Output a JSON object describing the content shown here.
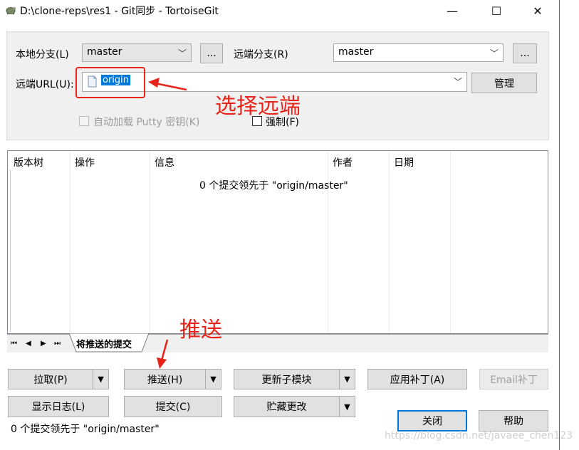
{
  "window": {
    "title": "D:\\clone-reps\\res1 - Git同步 - TortoiseGit",
    "controls": {
      "minimize": "—",
      "maximize": "☐",
      "close": "✕"
    }
  },
  "form": {
    "local_branch_label": "本地分支(L)",
    "local_branch_value": "master",
    "remote_branch_label": "远端分支(R)",
    "remote_branch_value": "master",
    "browse_label": "...",
    "remote_url_label": "远端URL(U):",
    "remote_url_value": "origin",
    "manage_label": "管理",
    "autoload_putty_label": "自动加载 Putty 密钥(K)",
    "force_label": "强制(F)"
  },
  "list": {
    "columns": [
      "版本树",
      "操作",
      "信息",
      "作者",
      "日期"
    ],
    "message": "0 个提交领先于 \"origin/master\""
  },
  "tabs": {
    "nav": [
      "⏮",
      "◀",
      "▶",
      "⏭"
    ],
    "active_tab": "将推送的提交"
  },
  "buttons": {
    "pull": "拉取(P)",
    "push": "推送(H)",
    "update_submodules": "更新子模块",
    "apply_patch": "应用补丁(A)",
    "email_patch": "Email补丁",
    "show_log": "显示日志(L)",
    "commit": "提交(C)",
    "stash": "贮藏更改",
    "close": "关闭",
    "help": "帮助",
    "dropdown_arrow": "▼"
  },
  "status": "0 个提交领先于 \"origin/master\"",
  "annotations": {
    "select_remote": "选择远端",
    "push": "推送"
  },
  "watermark": "https://blog.csdn.net/javaee_chen123",
  "colors": {
    "annotation_red": "#e8231a",
    "selection_blue": "#0078d7",
    "default_button_border": "#0078d7"
  }
}
